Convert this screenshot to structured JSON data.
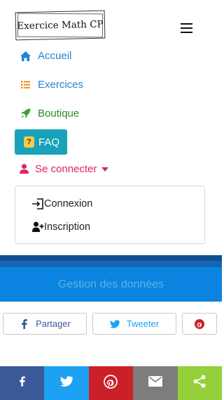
{
  "header": {
    "logo_text": "Exercice Math CP",
    "menu_icon": "hamburger-icon"
  },
  "nav": {
    "accueil": {
      "label": "Accueil",
      "icon": "home-icon"
    },
    "exercices": {
      "label": "Exercices",
      "icon": "list-icon"
    },
    "boutique": {
      "label": "Boutique",
      "icon": "rocket-icon"
    },
    "faq": {
      "label": "FAQ",
      "icon": "question-icon"
    },
    "connect": {
      "label": "Se connecter",
      "icon": "user-icon"
    }
  },
  "dropdown": {
    "connexion": {
      "label": "Connexion",
      "icon": "sign-in-icon"
    },
    "inscription": {
      "label": "Inscription",
      "icon": "user-plus-icon"
    }
  },
  "banner": {
    "label": "Gestion des données"
  },
  "share": {
    "facebook": "Partager",
    "twitter": "Tweeter"
  },
  "colors": {
    "link_blue": "#1f84d6",
    "boutique_green": "#2a8a2a",
    "faq_teal": "#17a2b8",
    "connect_pink": "#e0245e",
    "banner_blue": "#0a84e0",
    "facebook": "#3b5998",
    "twitter": "#1da1f2",
    "pinterest": "#cb2027",
    "mail": "#7d7d7d",
    "share": "#95d03a"
  }
}
